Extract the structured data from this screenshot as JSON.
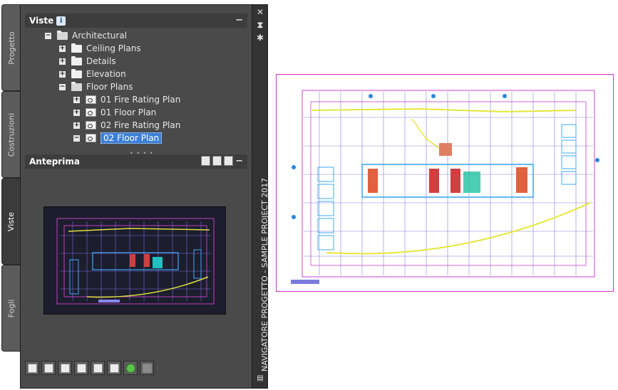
{
  "side_tabs": [
    {
      "label": "Progetto",
      "active": false
    },
    {
      "label": "Costruzioni",
      "active": false
    },
    {
      "label": "Viste",
      "active": true
    },
    {
      "label": "Fogli",
      "active": false
    }
  ],
  "palette_title": "NAVIGATORE PROGETTO - SAMPLE PROJECT 2017",
  "views_panel": {
    "title": "Viste",
    "info_icon": "i",
    "collapse_glyph": "−"
  },
  "tree": [
    {
      "label": "Architectural",
      "level": 0,
      "expander": "−",
      "icon": "folder-open-icon"
    },
    {
      "label": "Ceiling Plans",
      "level": 1,
      "expander": "+",
      "icon": "folder-icon"
    },
    {
      "label": "Details",
      "level": 1,
      "expander": "+",
      "icon": "folder-icon"
    },
    {
      "label": "Elevation",
      "level": 1,
      "expander": "+",
      "icon": "folder-icon"
    },
    {
      "label": "Floor Plans",
      "level": 1,
      "expander": "−",
      "icon": "folder-open-icon"
    },
    {
      "label": "01 Fire Rating Plan",
      "level": 2,
      "expander": "+",
      "icon": "view-icon"
    },
    {
      "label": "01 Floor Plan",
      "level": 2,
      "expander": "+",
      "icon": "view-icon"
    },
    {
      "label": "02 Fire Rating Plan",
      "level": 2,
      "expander": "+",
      "icon": "view-icon"
    },
    {
      "label": "02 Floor Plan",
      "level": 2,
      "expander": "−",
      "icon": "view-icon",
      "selected": true
    }
  ],
  "preview_panel": {
    "title": "Anteprima",
    "collapse_glyph": "−"
  },
  "strip_buttons": {
    "close": "✕",
    "autohide": "⧗",
    "settings": "✱"
  },
  "toolbar_icons": [
    "new-view-icon",
    "new-model-view-icon",
    "new-detail-view-icon",
    "properties-icon",
    "open-view-icon",
    "insert-view-icon",
    "refresh-icon",
    "repath-icon"
  ],
  "colors": {
    "panel_bg": "#4a4a4a",
    "header_bg": "#3d3d3d",
    "selection": "#3c7fd6",
    "drawing_border": "#cc33cc"
  }
}
